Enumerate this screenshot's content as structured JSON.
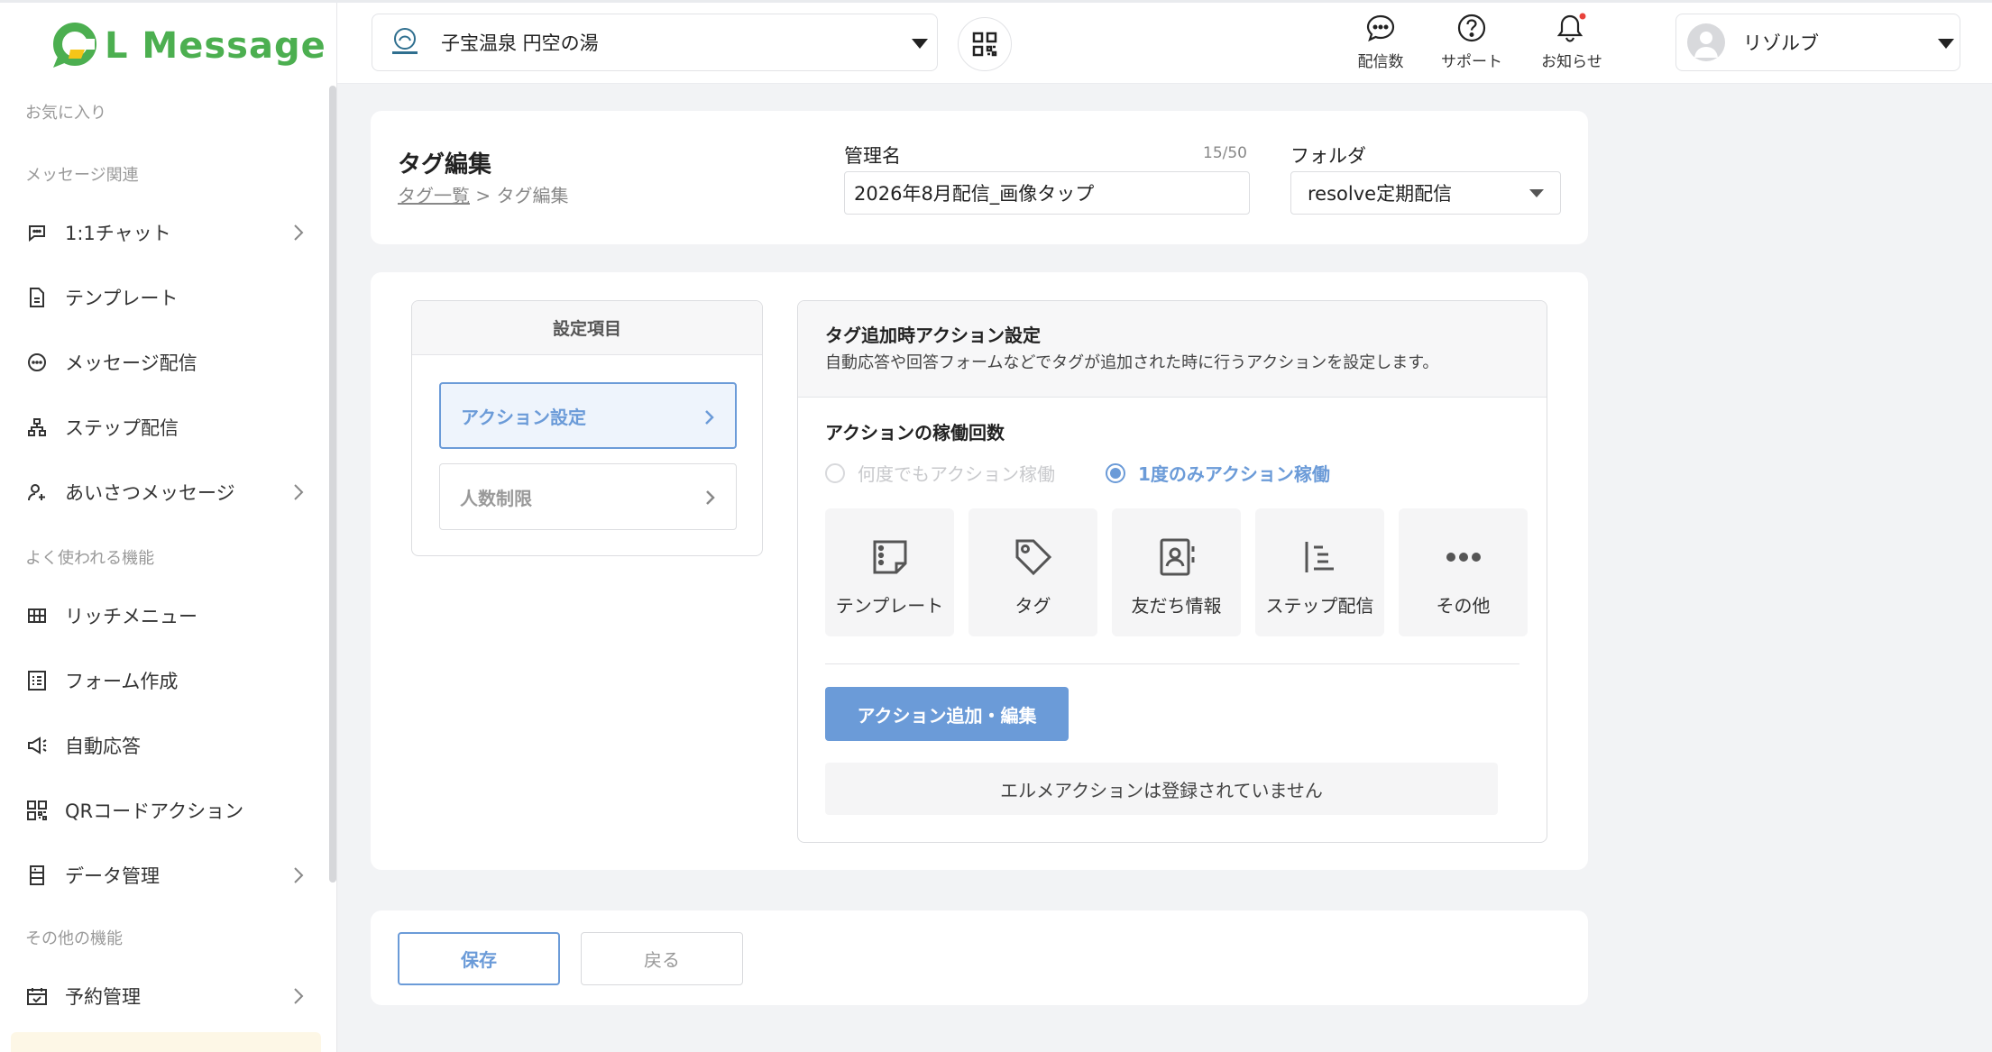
{
  "app": {
    "logo_text": "L Message",
    "brand_color": "#4caf50",
    "accent_color": "#6b9bd8"
  },
  "header": {
    "account_name": "子宝温泉 円空の湯",
    "icons": [
      {
        "label": "配信数",
        "icon": "chat-bubble-icon"
      },
      {
        "label": "サポート",
        "icon": "question-circle-icon"
      },
      {
        "label": "お知らせ",
        "icon": "bell-icon"
      }
    ],
    "user_name": "リゾルブ"
  },
  "sidebar": {
    "sections": [
      "お気に入り",
      "メッセージ関連",
      "よく使われる機能",
      "その他の機能"
    ],
    "items": [
      {
        "label": "1:1チャット",
        "icon": "chat-icon",
        "has_chevron": true
      },
      {
        "label": "テンプレート",
        "icon": "document-icon",
        "has_chevron": false
      },
      {
        "label": "メッセージ配信",
        "icon": "message-icon",
        "has_chevron": false
      },
      {
        "label": "ステップ配信",
        "icon": "hierarchy-icon",
        "has_chevron": false
      },
      {
        "label": "あいさつメッセージ",
        "icon": "user-add-icon",
        "has_chevron": true
      },
      {
        "label": "リッチメニュー",
        "icon": "grid-icon",
        "has_chevron": false
      },
      {
        "label": "フォーム作成",
        "icon": "form-icon",
        "has_chevron": false
      },
      {
        "label": "自動応答",
        "icon": "megaphone-icon",
        "has_chevron": false
      },
      {
        "label": "QRコードアクション",
        "icon": "qr-icon",
        "has_chevron": false
      },
      {
        "label": "データ管理",
        "icon": "database-icon",
        "has_chevron": true
      },
      {
        "label": "予約管理",
        "icon": "calendar-icon",
        "has_chevron": true
      }
    ]
  },
  "page": {
    "title": "タグ編集",
    "breadcrumb": {
      "parent": "タグ一覧",
      "separator": ">",
      "current": "タグ編集"
    },
    "name_field": {
      "label": "管理名",
      "value": "2026年8月配信_画像タップ",
      "count": "15/50"
    },
    "folder_field": {
      "label": "フォルダ",
      "value": "resolve定期配信"
    }
  },
  "settings": {
    "header": "設定項目",
    "items": [
      {
        "label": "アクション設定",
        "active": true
      },
      {
        "label": "人数制限",
        "active": false
      }
    ]
  },
  "action": {
    "title": "タグ追加時アクション設定",
    "description": "自動応答や回答フォームなどでタグが追加された時に行うアクションを設定します。",
    "count_title": "アクションの稼働回数",
    "radio_options": [
      {
        "label": "何度でもアクション稼働",
        "selected": false
      },
      {
        "label": "1度のみアクション稼働",
        "selected": true
      }
    ],
    "tiles": [
      {
        "label": "テンプレート",
        "icon": "template-icon"
      },
      {
        "label": "タグ",
        "icon": "tag-icon"
      },
      {
        "label": "友だち情報",
        "icon": "contact-card-icon"
      },
      {
        "label": "ステップ配信",
        "icon": "step-list-icon"
      },
      {
        "label": "その他",
        "icon": "more-dots-icon"
      }
    ],
    "add_button": "アクション追加・編集",
    "empty_message": "エルメアクションは登録されていません"
  },
  "footer": {
    "save": "保存",
    "back": "戻る"
  }
}
